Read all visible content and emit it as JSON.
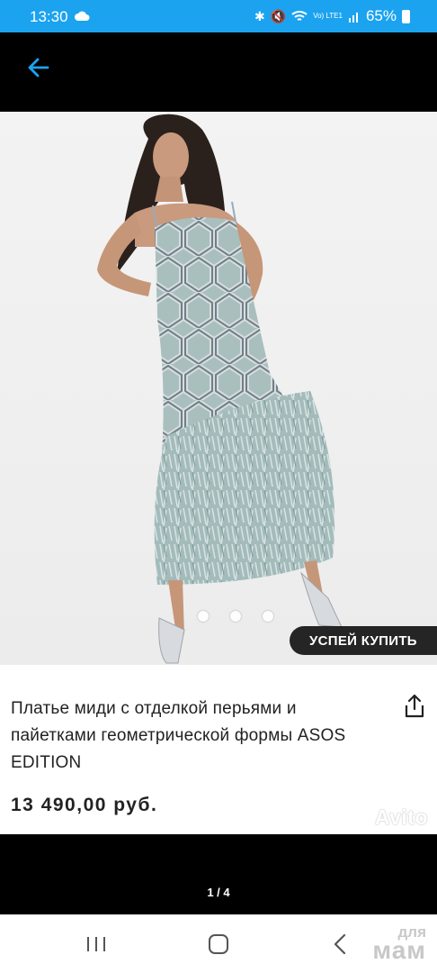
{
  "status": {
    "time": "13:30",
    "battery": "65%",
    "network_label": "Vo) LTE1"
  },
  "topbar": {
    "back_icon": "arrow-left-icon"
  },
  "gallery": {
    "promo_label": "УСПЕЙ КУПИТЬ",
    "counter": "1 / 4",
    "dots": 3
  },
  "product": {
    "title": "Платье миди с отделкой перьями и пайетками геометрической формы ASOS EDITION",
    "price": "13 490,00 руб.",
    "share_icon": "share-icon"
  },
  "watermarks": {
    "avito": "Avito",
    "site_small": "для",
    "site_big": "мам"
  },
  "navbar": {
    "recent_icon": "recent-apps-icon",
    "home_icon": "home-icon",
    "back_icon": "back-chevron-icon"
  },
  "colors": {
    "status_bar": "#1ba3f0",
    "accent_arrow": "#1ba3f0",
    "dress": "#9fb8b6"
  }
}
